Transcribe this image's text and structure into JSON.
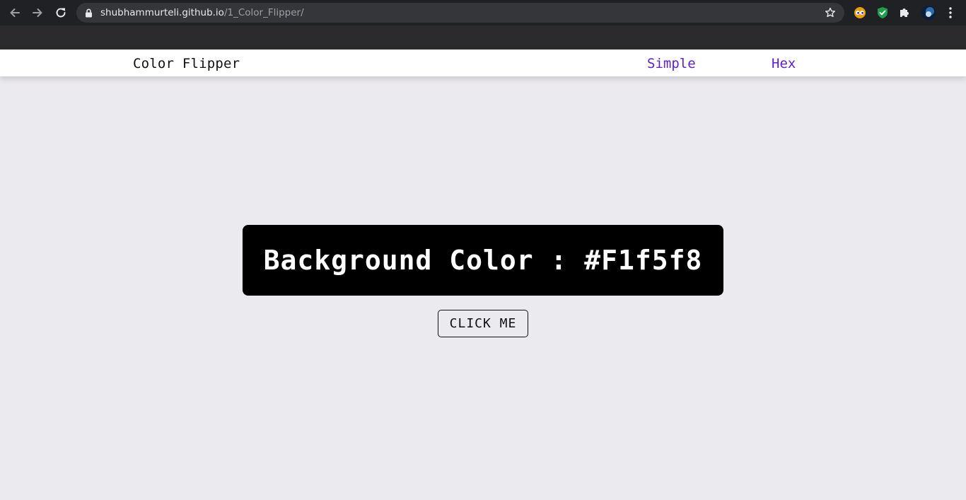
{
  "browser": {
    "url_host": "shubhammurteli.github.io",
    "url_path": "/1_Color_Flipper/",
    "icons": {
      "back": "arrow-left-icon",
      "forward": "arrow-right-icon",
      "reload": "reload-icon",
      "lock": "lock-icon",
      "bookmark": "star-icon",
      "extension_1": "eyes-extension-icon",
      "extension_2": "shield-check-icon",
      "extensions": "puzzle-icon",
      "profile": "avatar-icon",
      "menu": "kebab-menu-icon"
    }
  },
  "navbar": {
    "brand": "Color Flipper",
    "links": [
      {
        "label": "Simple"
      },
      {
        "label": "Hex"
      }
    ]
  },
  "main": {
    "color_label": "Background Color : #F1f5f8",
    "button_label": "CLICK ME"
  },
  "colors": {
    "page_background": "#ebeaef",
    "nav_link": "#5b1fd6",
    "color_box": "#000000",
    "color_text": "#ffffff"
  }
}
